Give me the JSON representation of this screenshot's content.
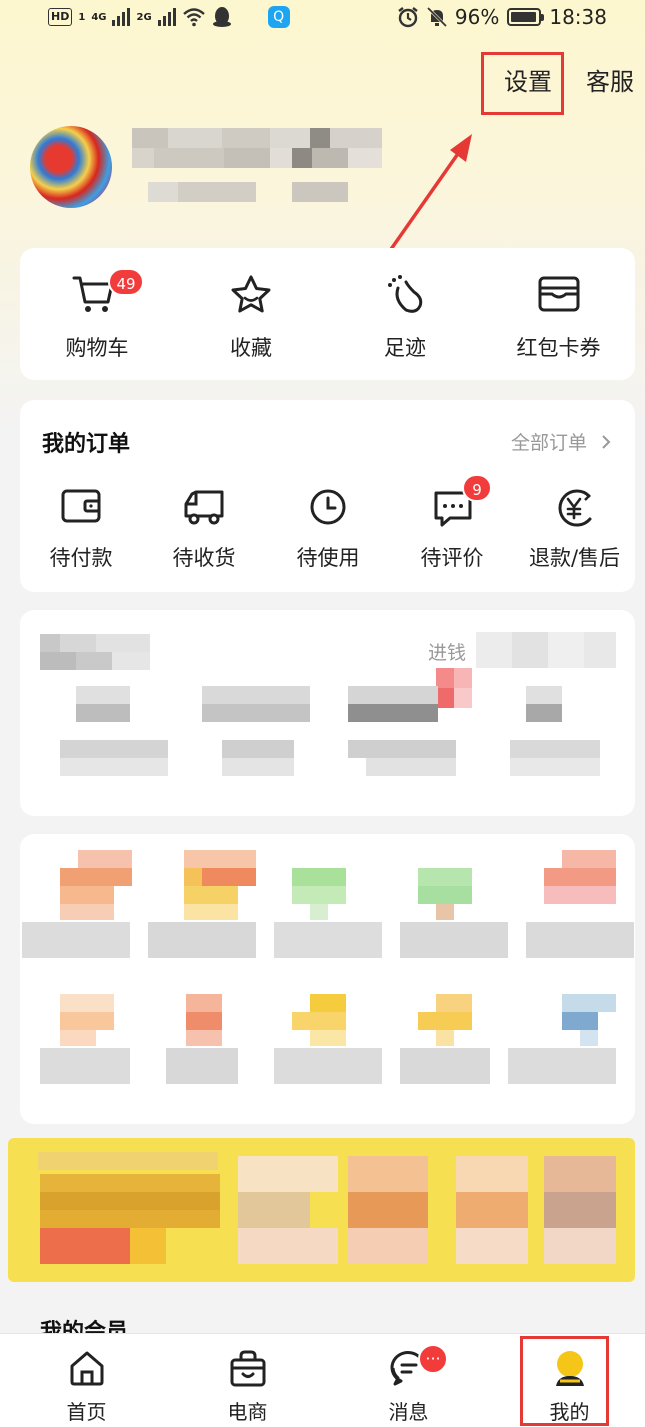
{
  "status_bar": {
    "hd": "HD",
    "sim": "1",
    "net1": "4G",
    "net2": "2G",
    "battery_pct": "96%",
    "time": "18:38"
  },
  "header": {
    "settings_label": "设置",
    "service_label": "客服"
  },
  "quick_links": [
    {
      "label": "购物车",
      "icon": "cart-icon",
      "badge": "49"
    },
    {
      "label": "收藏",
      "icon": "star-icon",
      "badge": ""
    },
    {
      "label": "足迹",
      "icon": "footprint-icon",
      "badge": ""
    },
    {
      "label": "红包卡券",
      "icon": "wallet-card-icon",
      "badge": ""
    }
  ],
  "orders": {
    "title": "我的订单",
    "all_label": "全部订单",
    "items": [
      {
        "label": "待付款",
        "icon": "wallet-icon",
        "badge": ""
      },
      {
        "label": "待收货",
        "icon": "truck-icon",
        "badge": ""
      },
      {
        "label": "待使用",
        "icon": "clock-icon",
        "badge": ""
      },
      {
        "label": "待评价",
        "icon": "comment-icon",
        "badge": "9"
      },
      {
        "label": "退款/售后",
        "icon": "yuan-refund-icon",
        "badge": ""
      }
    ]
  },
  "blurred_section": {
    "partial_label": "进钱"
  },
  "member": {
    "title": "我的会员"
  },
  "bottom_nav": [
    {
      "label": "首页",
      "icon": "home-icon",
      "badge": ""
    },
    {
      "label": "电商",
      "icon": "shop-bag-icon",
      "badge": ""
    },
    {
      "label": "消息",
      "icon": "message-icon",
      "badge": "···"
    },
    {
      "label": "我的",
      "icon": "profile-icon",
      "badge": ""
    }
  ],
  "colors": {
    "accent_red": "#f23b3b",
    "highlight_box": "#e53935",
    "banner_yellow": "#f7df52",
    "profile_yellow": "#f5c518"
  }
}
